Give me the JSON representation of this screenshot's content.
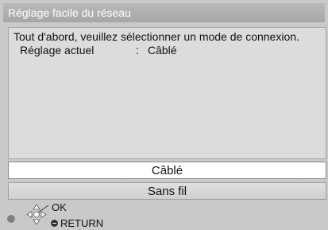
{
  "dialog": {
    "title": "Réglage facile du réseau",
    "instruction": "Tout d'abord, veuillez sélectionner un mode de connexion.",
    "current_setting_label": "Réglage actuel",
    "separator": ":",
    "current_setting_value": "Câblé"
  },
  "options": [
    {
      "label": "Câblé",
      "selected": true
    },
    {
      "label": "Sans fil",
      "selected": false
    }
  ],
  "footer": {
    "ok_label": "OK",
    "return_label": "RETURN",
    "icons": [
      "indicator-dot-icon",
      "dpad-icon",
      "return-icon"
    ]
  }
}
